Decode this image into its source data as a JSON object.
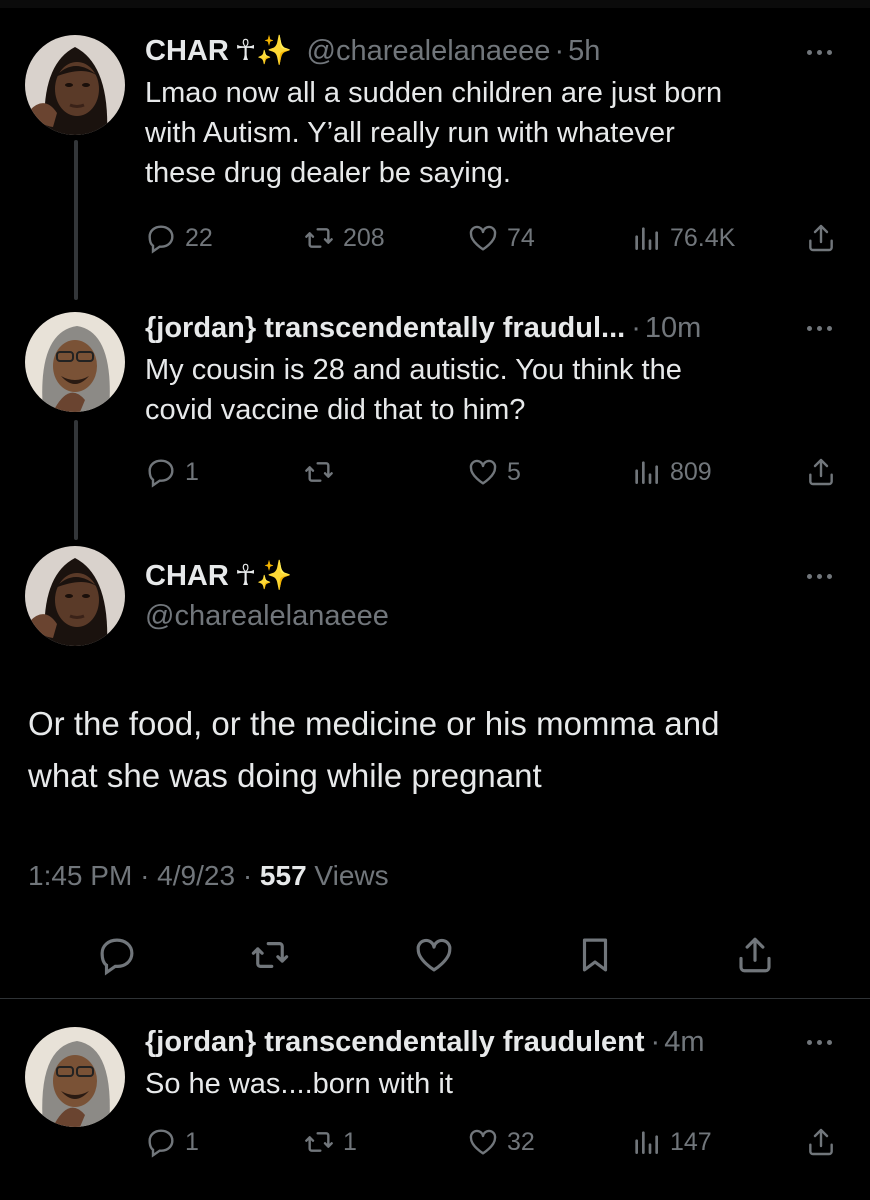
{
  "tweets": [
    {
      "name": "CHAR",
      "emoji": "☥✨",
      "handle": "@charealelanaeee",
      "time": "5h",
      "text_lines": [
        "Lmao now all a sudden children are just born",
        "with Autism. Y’all really run with whatever",
        "these drug dealer be saying."
      ],
      "replies": "22",
      "reposts": "208",
      "likes": "74",
      "views": "76.4K"
    },
    {
      "name": "{jordan} transcendentally fraudul...",
      "handle": "",
      "time": "10m",
      "text_lines": [
        "My cousin is 28 and autistic. You think the",
        "covid vaccine did that to him?"
      ],
      "replies": "1",
      "reposts": "",
      "likes": "5",
      "views": "809"
    }
  ],
  "main_tweet": {
    "name": "CHAR",
    "emoji": "☥✨",
    "handle": "@charealelanaeee",
    "text_lines": [
      "Or the food, or the medicine or his momma and",
      "what she was doing while pregnant"
    ],
    "time": "1:45 PM",
    "date": "4/9/23",
    "views_count": "557",
    "views_label": "Views"
  },
  "reply": {
    "name": "{jordan} transcendentally fraudulent",
    "time": "4m",
    "text": "So he was....born with it",
    "replies": "1",
    "reposts": "1",
    "likes": "32",
    "views": "147"
  },
  "separator": "·",
  "colors": {
    "background": "#000000",
    "text": "#e7e9ea",
    "muted": "#71767b",
    "divider": "#2f3336"
  }
}
